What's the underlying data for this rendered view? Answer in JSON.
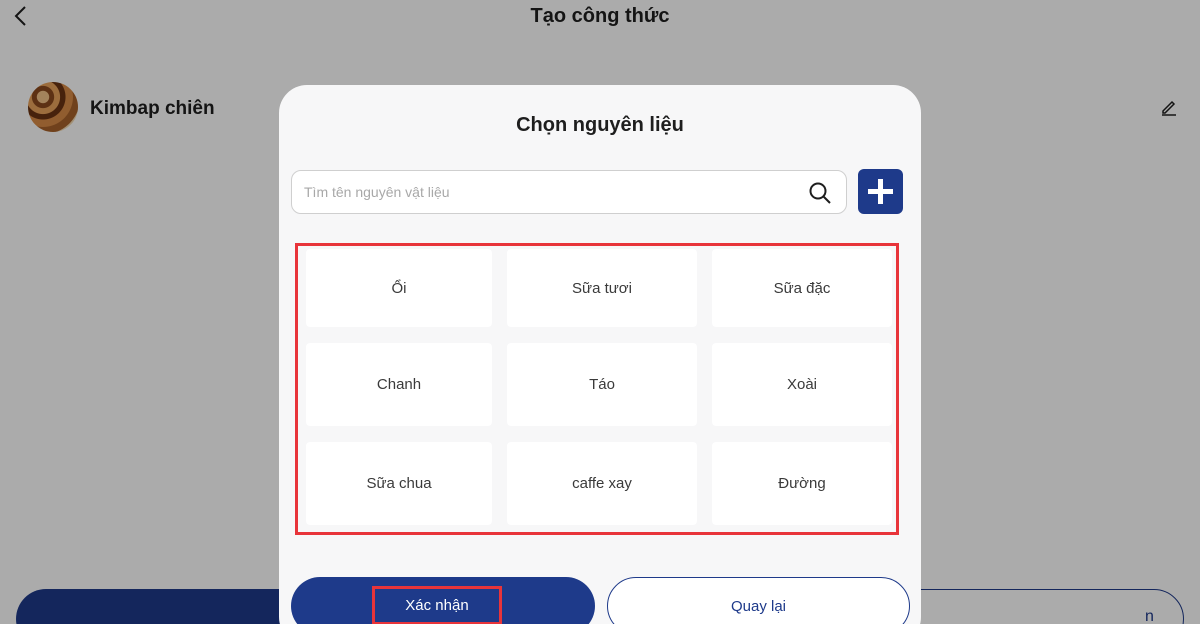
{
  "header": {
    "title": "Tạo công thức"
  },
  "recipe": {
    "name": "Kimbap chiên"
  },
  "bottom_bar": {
    "right_fragment": "n"
  },
  "modal": {
    "title": "Chọn nguyên liệu",
    "search": {
      "placeholder": "Tìm tên nguyên vật liệu",
      "value": ""
    },
    "ingredients": [
      {
        "label": "Ổi"
      },
      {
        "label": "Sữa tươi"
      },
      {
        "label": "Sữa đặc"
      },
      {
        "label": "Chanh"
      },
      {
        "label": "Táo"
      },
      {
        "label": "Xoài"
      },
      {
        "label": "Sữa chua"
      },
      {
        "label": "caffe xay"
      },
      {
        "label": "Đường"
      }
    ],
    "confirm_label": "Xác nhận",
    "back_label": "Quay lại"
  },
  "colors": {
    "primary": "#1e3a8a",
    "highlight": "#e8343a",
    "dim_overlay": "rgba(0,0,0,0.33)"
  }
}
